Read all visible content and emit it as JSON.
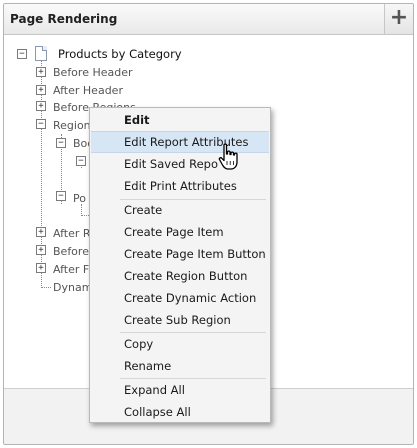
{
  "panel": {
    "title": "Page Rendering",
    "add_icon": "+"
  },
  "tree": {
    "root_label": "Products by Category",
    "before_header": "Before Header",
    "after_header": "After Header",
    "before_regions": "Before Regions",
    "regions": "Regions",
    "body": "Body",
    "position": "Po",
    "after_regions": "After R",
    "before_footer": "Before",
    "after_footer": "After Fo",
    "dynamic": "Dynam",
    "expand_glyph": "+",
    "collapse_glyph": "−"
  },
  "context_menu": {
    "items": [
      {
        "label": "Edit"
      },
      {
        "label": "Edit Report Attributes"
      },
      {
        "label": "Edit Saved Repo"
      },
      {
        "label": "Edit Print Attributes"
      },
      {
        "label": "Create"
      },
      {
        "label": "Create Page Item"
      },
      {
        "label": "Create Page Item Button"
      },
      {
        "label": "Create Region Button"
      },
      {
        "label": "Create Dynamic Action"
      },
      {
        "label": "Create Sub Region"
      },
      {
        "label": "Copy"
      },
      {
        "label": "Rename"
      },
      {
        "label": "Expand All"
      },
      {
        "label": "Collapse All"
      }
    ],
    "hovered_item": "Edit Report Attributes"
  },
  "icons": {
    "page": "page-icon",
    "cursor": "hand-pointer-icon"
  }
}
